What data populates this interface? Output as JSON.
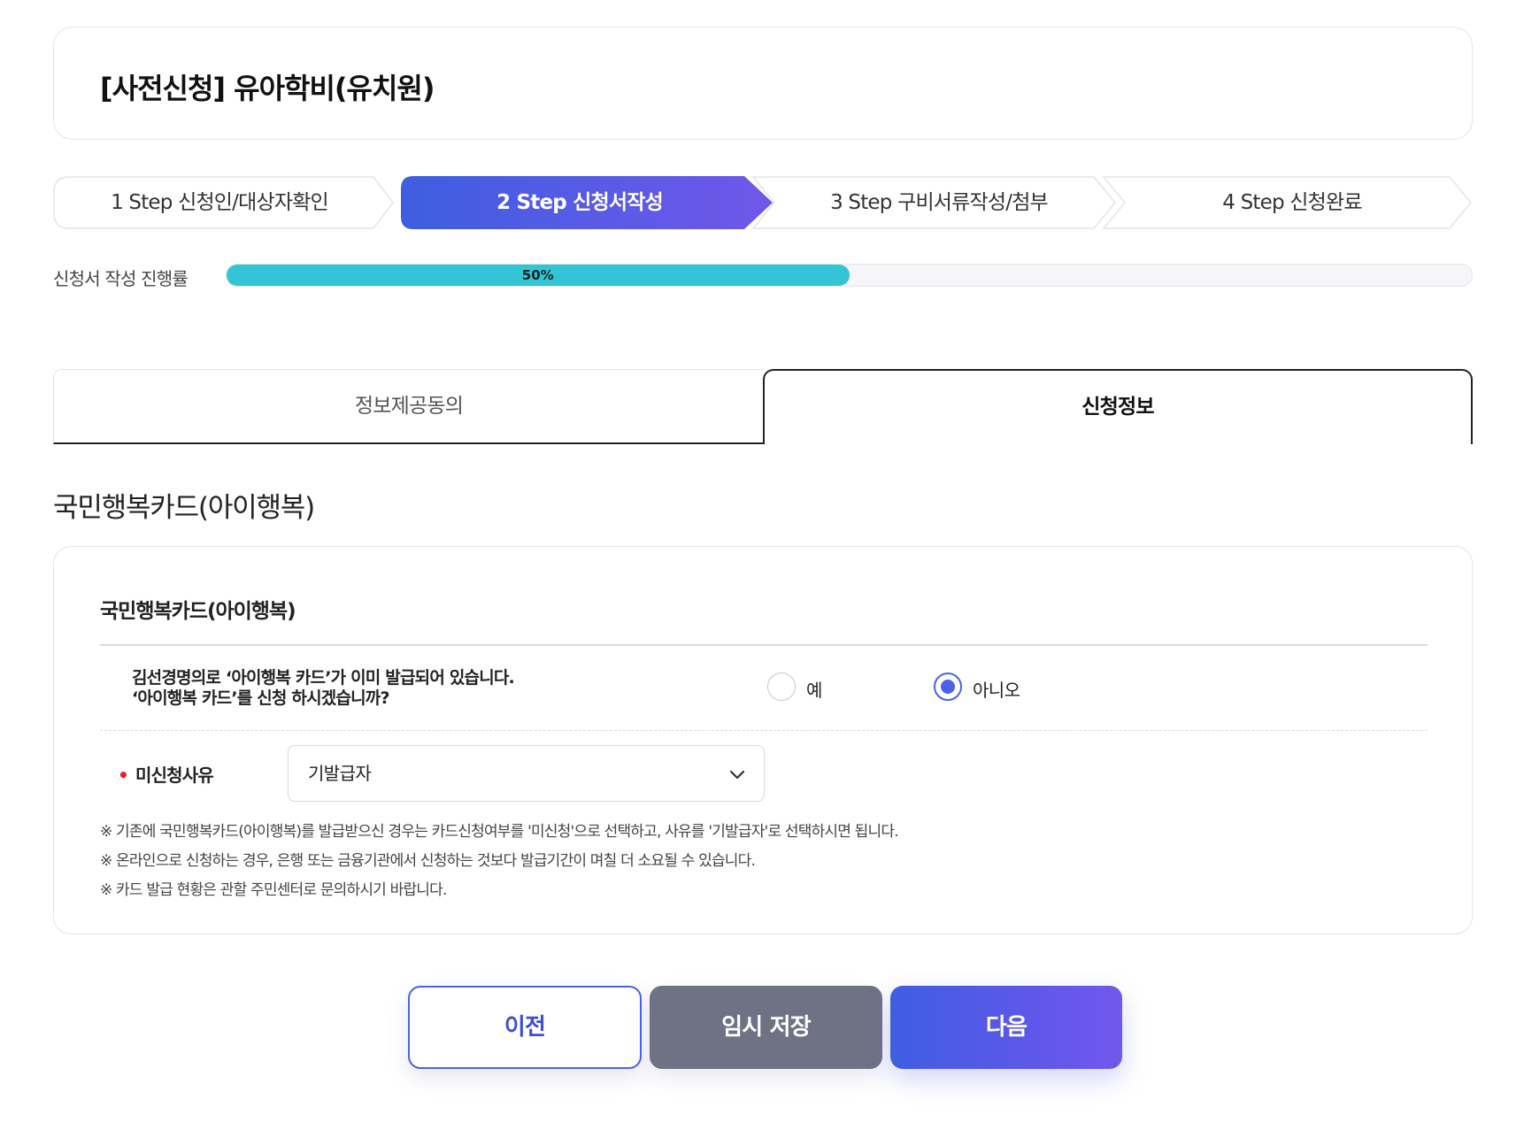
{
  "page": {
    "title": "[사전신청] 유아학비(유치원)"
  },
  "steps": [
    {
      "label": "1 Step 신청인/대상자확인",
      "active": false
    },
    {
      "label": "2 Step 신청서작성",
      "active": true
    },
    {
      "label": "3 Step 구비서류작성/첨부",
      "active": false
    },
    {
      "label": "4 Step 신청완료",
      "active": false
    }
  ],
  "progress": {
    "label": "신청서 작성 진행률",
    "value": 50,
    "value_text": "50%"
  },
  "tabs": [
    {
      "label": "정보제공동의",
      "selected": false
    },
    {
      "label": "신청정보",
      "selected": true
    }
  ],
  "section": {
    "heading": "국민행복카드(아이행복)",
    "card_title": "국민행복카드(아이행복)",
    "question_line1": "김선경명의로 ‘아이행복 카드’가 이미 발급되어 있습니다.",
    "question_line2": "‘아이행복 카드’를 신청 하시겠습니까?",
    "options": [
      {
        "label": "예",
        "checked": false
      },
      {
        "label": "아니오",
        "checked": true
      }
    ],
    "reason_label": "미신청사유",
    "reason_value": "기발급자",
    "notes": [
      "※ 기존에 국민행복카드(아이행복)를 발급받으신 경우는 카드신청여부를 '미신청'으로 선택하고, 사유를 '기발급자'로 선택하시면 됩니다.",
      "※ 온라인으로 신청하는 경우, 은행 또는 금융기관에서 신청하는 것보다 발급기간이 며칠 더 소요될 수 있습니다.",
      "※ 카드 발급 현황은 관할 주민센터로 문의하시기 바랍니다."
    ]
  },
  "buttons": {
    "prev": "이전",
    "temp_save": "임시 저장",
    "next": "다음"
  },
  "colors": {
    "accent": "#4b61e8",
    "progress": "#33c5d6",
    "required_dot": "#e0262d",
    "temp_button": "#6f7285"
  },
  "icons": {
    "select_chevron": "chevron-down-icon"
  }
}
